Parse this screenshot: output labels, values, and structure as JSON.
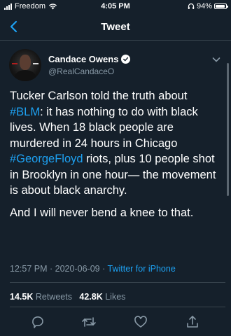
{
  "status_bar": {
    "carrier": "Freedom",
    "time": "4:05 PM",
    "battery": "94%",
    "battery_level": 0.94
  },
  "nav": {
    "title": "Tweet",
    "back_icon": "chevron-left-icon"
  },
  "author": {
    "name": "Candace Owens",
    "handle": "@RealCandaceO",
    "verified": true
  },
  "tweet": {
    "segments_p1": [
      {
        "text": "Tucker Carlson told the truth about ",
        "type": "text"
      },
      {
        "text": "#BLM",
        "type": "hashtag"
      },
      {
        "text": ": it has nothing to do with black lives. When 18 black people are murdered in 24 hours in Chicago ",
        "type": "text"
      },
      {
        "text": "#GeorgeFloyd",
        "type": "hashtag"
      },
      {
        "text": " riots, plus 10 people shot in Brooklyn in one hour— the movement is about black anarchy.",
        "type": "text"
      }
    ],
    "paragraph_2": "And I will never bend a knee to that.",
    "time": "12:57 PM",
    "date": "2020-06-09",
    "separator": "·",
    "source": "Twitter for iPhone"
  },
  "stats": {
    "retweets_count": "14.5K",
    "retweets_label": "Retweets",
    "likes_count": "42.8K",
    "likes_label": "Likes"
  },
  "actions": [
    "reply-icon",
    "retweet-icon",
    "like-icon",
    "share-icon"
  ],
  "colors": {
    "background": "#15202b",
    "accent": "#1da1f2",
    "secondary_text": "#8899a6",
    "divider": "#38444d"
  }
}
